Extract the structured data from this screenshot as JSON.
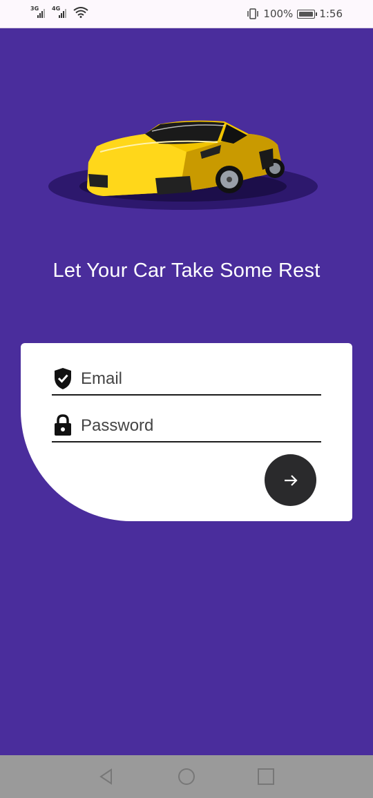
{
  "status_bar": {
    "network_1": "3G",
    "network_2": "4G",
    "battery": "100%",
    "time": "1:56"
  },
  "hero": {
    "image": "yellow-sports-car",
    "tagline": "Let Your Car Take Some Rest"
  },
  "login": {
    "email_placeholder": "Email",
    "email_icon": "shield-check-icon",
    "password_placeholder": "Password",
    "password_icon": "lock-icon",
    "submit_icon": "arrow-right-icon"
  },
  "nav": {
    "back_icon": "back-triangle-icon",
    "home_icon": "home-circle-icon",
    "recents_icon": "recents-square-icon"
  },
  "colors": {
    "background": "#4a2d9c",
    "card": "#ffffff",
    "button": "#2a2a2c",
    "car": "#f2c400"
  }
}
